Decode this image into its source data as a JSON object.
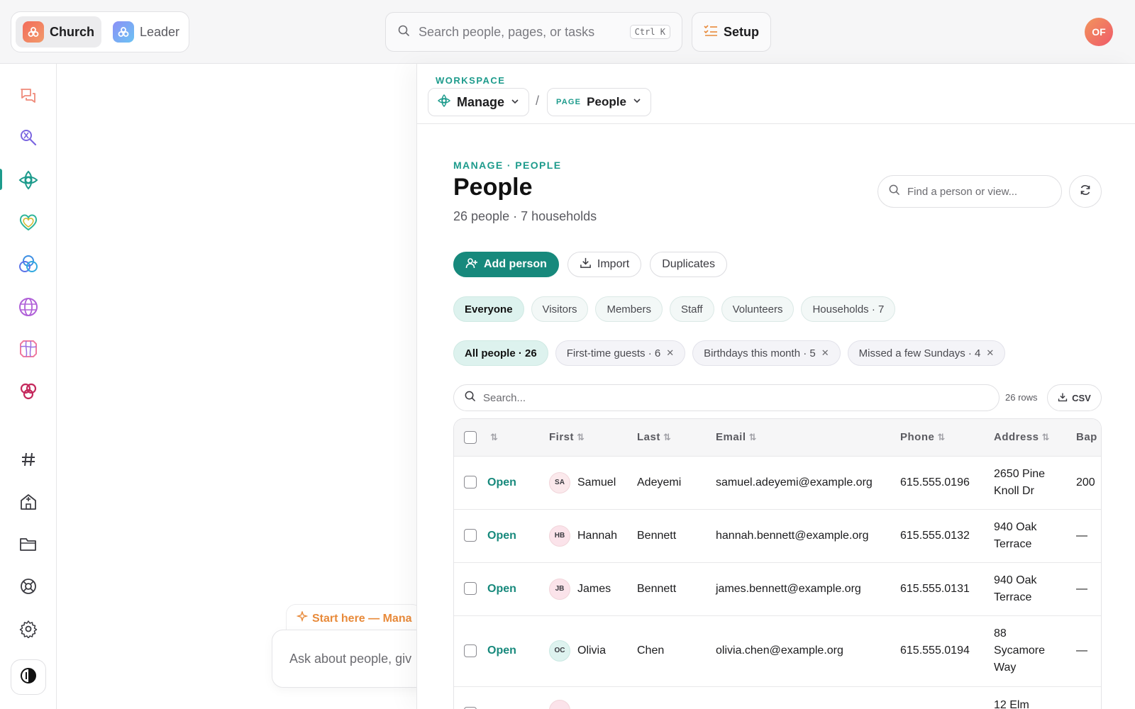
{
  "topbar": {
    "modes": [
      {
        "label": "Church",
        "active": true
      },
      {
        "label": "Leader",
        "active": false
      }
    ],
    "search_placeholder": "Search people, pages, or tasks",
    "search_shortcut": "Ctrl K",
    "setup_label": "Setup",
    "avatar_initials": "OF"
  },
  "rail": {
    "items": [
      "chat-icon",
      "search-people-icon",
      "manage-icon",
      "care-icon",
      "groups-icon",
      "globe-icon",
      "media-icon",
      "giving-icon",
      "hashtag-icon",
      "building-icon",
      "folder-icon",
      "help-icon",
      "settings-icon"
    ],
    "active": "manage-icon"
  },
  "assistant": {
    "chip": "Start here — Mana",
    "placeholder": "Ask about people, giv"
  },
  "breadcrumb": {
    "workspace_label": "WORKSPACE",
    "workspace": "Manage",
    "separator": "/",
    "page_tag": "PAGE",
    "page": "People"
  },
  "header": {
    "eyebrow": "MANAGE · PEOPLE",
    "title": "People",
    "subtitle": "26 people · 7 households",
    "find_placeholder": "Find a person or view..."
  },
  "actions": {
    "add_person": "Add person",
    "import": "Import",
    "duplicates": "Duplicates"
  },
  "filters": [
    {
      "label": "Everyone",
      "active": true
    },
    {
      "label": "Visitors",
      "active": false
    },
    {
      "label": "Members",
      "active": false
    },
    {
      "label": "Staff",
      "active": false
    },
    {
      "label": "Volunteers",
      "active": false
    },
    {
      "label": "Households · 7",
      "active": false
    }
  ],
  "views": [
    {
      "label": "All people · 26",
      "active": true,
      "removable": false
    },
    {
      "label": "First-time guests · 6",
      "active": false,
      "removable": true
    },
    {
      "label": "Birthdays this month · 5",
      "active": false,
      "removable": true
    },
    {
      "label": "Missed a few Sundays · 4",
      "active": false,
      "removable": true
    }
  ],
  "table": {
    "search_placeholder": "Search...",
    "row_count": "26 rows",
    "csv_label": "CSV",
    "sort_glyph": "⇅",
    "columns": [
      "First",
      "Last",
      "Email",
      "Phone",
      "Address",
      "Bap"
    ],
    "open_label": "Open",
    "rows": [
      {
        "initials": "SA",
        "first": "Samuel",
        "last": "Adeyemi",
        "email": "samuel.adeyemi@example.org",
        "phone": "615.555.0196",
        "address": "2650 Pine Knoll Dr",
        "bap": "200",
        "avatar_color": "#fbe9ec"
      },
      {
        "initials": "HB",
        "first": "Hannah",
        "last": "Bennett",
        "email": "hannah.bennett@example.org",
        "phone": "615.555.0132",
        "address": "940 Oak Terrace",
        "bap": "—",
        "avatar_color": "#fbe3ea"
      },
      {
        "initials": "JB",
        "first": "James",
        "last": "Bennett",
        "email": "james.bennett@example.org",
        "phone": "615.555.0131",
        "address": "940 Oak Terrace",
        "bap": "—",
        "avatar_color": "#fbe3ea"
      },
      {
        "initials": "OC",
        "first": "Olivia",
        "last": "Chen",
        "email": "olivia.chen@example.org",
        "phone": "615.555.0194",
        "address": "88 Sycamore Way",
        "bap": "—",
        "avatar_color": "#def3ef"
      },
      {
        "initials": "",
        "first": "",
        "last": "",
        "email": "",
        "phone": "",
        "address": "12 Elm",
        "bap": "",
        "avatar_color": "#fbe3ea"
      }
    ]
  },
  "colors": {
    "accent": "#17897c",
    "accent_text": "#1d9b8c",
    "assistant": "#e88a3a"
  }
}
